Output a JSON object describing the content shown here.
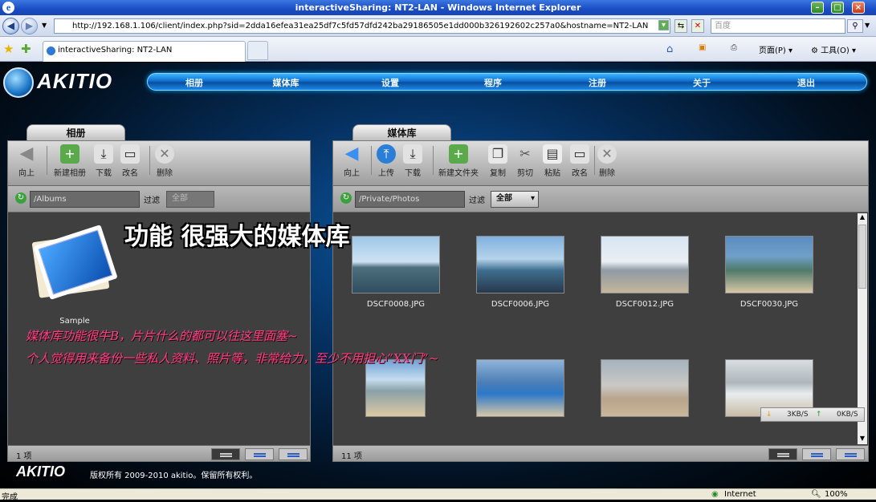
{
  "window": {
    "title": "interactiveSharing: NT2-LAN - Windows Internet Explorer"
  },
  "address": {
    "url": "http://192.168.1.106/client/index.php?sid=2dda16efea31ea25df7c5fd57dfd242ba29186505e1dd000b326192602c257a0&hostname=NT2-LAN",
    "search_placeholder": "百度"
  },
  "tab": {
    "title": "interactiveSharing: NT2-LAN"
  },
  "ietools": {
    "page": "页面(P)",
    "tools": "工具(O)"
  },
  "logo": {
    "text": "AKITIO"
  },
  "menu": [
    "相册",
    "媒体库",
    "设置",
    "程序",
    "注册",
    "关于",
    "退出"
  ],
  "album": {
    "tab": "相册",
    "toolbar": [
      "向上",
      "新建相册",
      "下载",
      "改名",
      "删除"
    ],
    "path": "/Albums",
    "filter_label": "过滤",
    "filter_value": "全部",
    "item": "Sample",
    "status": "1 项"
  },
  "media": {
    "tab": "媒体库",
    "toolbar": [
      "向上",
      "上传",
      "下载",
      "新建文件夹",
      "复制",
      "剪切",
      "粘贴",
      "改名",
      "删除"
    ],
    "path": "/Private/Photos",
    "filter_label": "过滤",
    "filter_value": "全部",
    "files": [
      "DSCF0008.JPG",
      "DSCF0006.JPG",
      "DSCF0012.JPG",
      "DSCF0030.JPG"
    ],
    "status": "11 项"
  },
  "overlay": {
    "headline": "功能 很强大的媒体库",
    "line1": "媒体库功能很牛B，片片什么的都可以往这里面塞~",
    "line2": "个人觉得用来备份一些私人资料、照片等，非常给力，至少不用担心“XX门”~"
  },
  "footer": {
    "copyright": "版权所有 2009-2010 akitio。保留所有权利。",
    "down": "3KB/S",
    "up": "0KB/S"
  },
  "statusbar": {
    "left": "完成",
    "zone": "Internet",
    "zoom": "100%"
  }
}
